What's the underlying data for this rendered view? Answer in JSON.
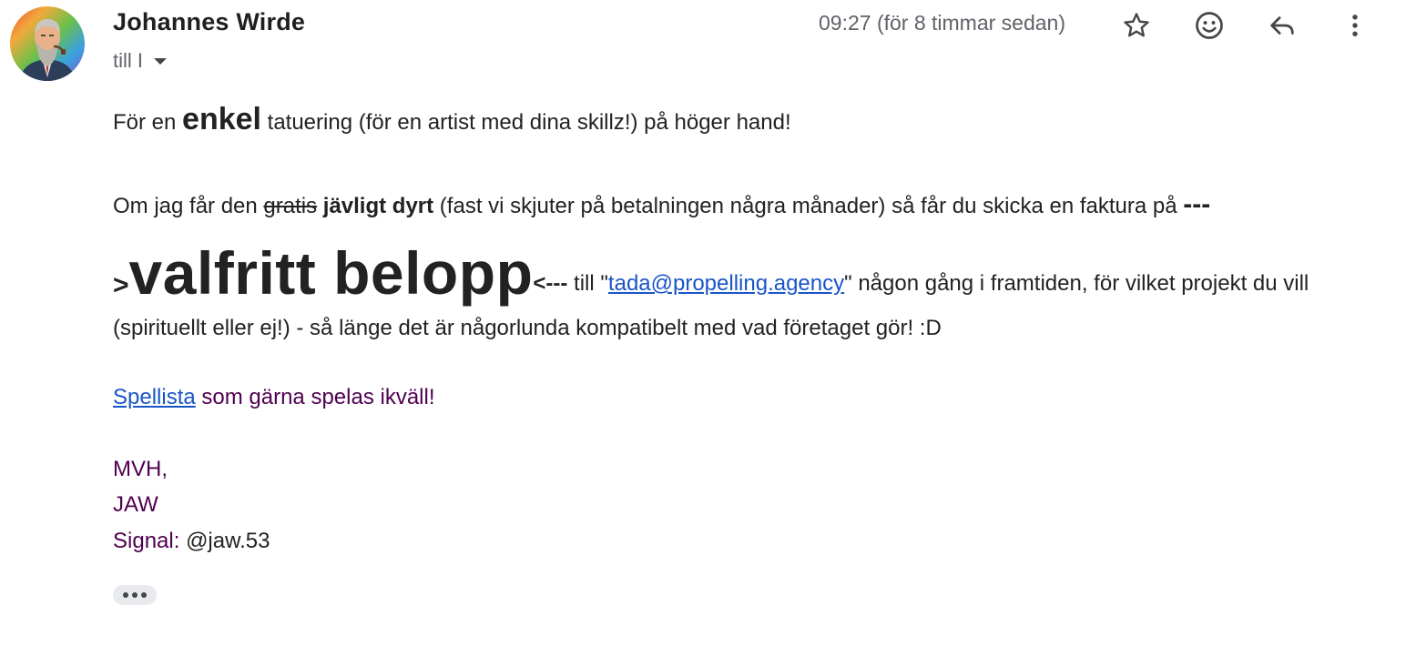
{
  "header": {
    "sender_name": "Johannes Wirde",
    "recipients": "till I",
    "timestamp": "09:27 (för 8 timmar sedan)",
    "avatar_icon": "bearded-man-avatar",
    "actions": {
      "star_icon": "star-icon",
      "emoji_icon": "emoji-reaction-icon",
      "reply_icon": "reply-icon",
      "more_icon": "more-vertical-icon"
    }
  },
  "message": {
    "p1": {
      "before": "För en ",
      "emphasis": "enkel",
      "after": " tatuering (för en artist med dina skillz!) på höger hand!"
    },
    "p2": {
      "start": "Om jag får den ",
      "strike": "gratis",
      "bold": " jävligt dyrt",
      "middle": " (fast vi skjuter på betalningen några månader) så får du skicka en faktura på ",
      "arrow_open": "---",
      "arrow_gt": ">",
      "amount": "valfritt belopp",
      "arrow_close": "<---",
      "till": " till \"",
      "email": "tada@propelling.agency",
      "after_email": "\" någon gång i framtiden, för vilket projekt du vill",
      "line3": "(spirituellt eller ej!) - så länge det är någorlunda kompatibelt med vad företaget gör! :D"
    },
    "p3": {
      "link": "Spellista",
      "after": " som gärna spelas ikväll!"
    },
    "signature": {
      "line1": "MVH,",
      "line2": "JAW",
      "label": "Signal: ",
      "handle": "@jaw.53"
    }
  },
  "colors": {
    "link": "#1a55c7",
    "quoted_purple": "#500050",
    "muted": "#5f6368"
  }
}
